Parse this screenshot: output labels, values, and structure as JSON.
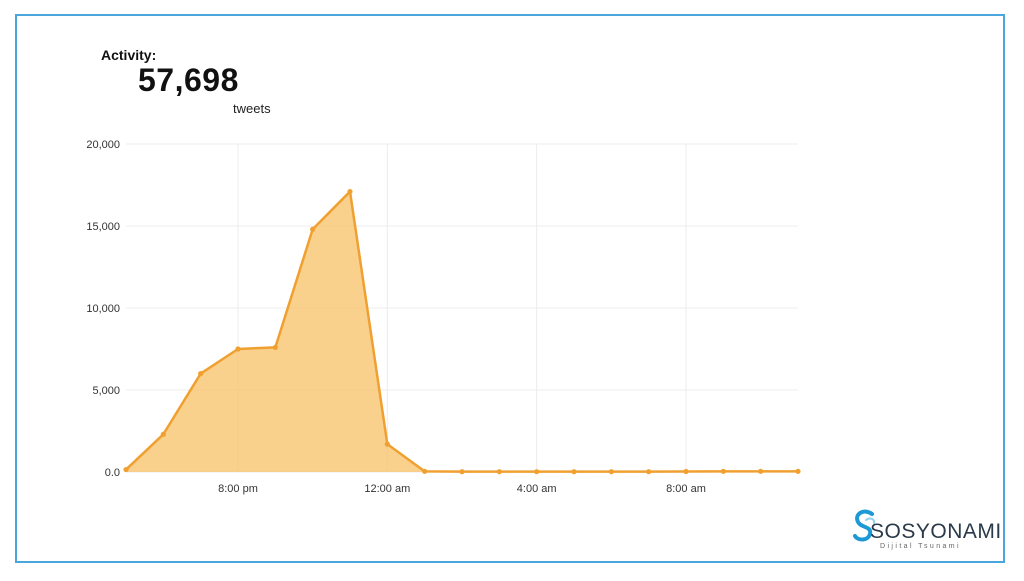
{
  "header": {
    "activity_label": "Activity:",
    "count": "57,698",
    "unit": "tweets"
  },
  "chart_data": {
    "type": "area",
    "title": "",
    "xlabel": "",
    "ylabel": "",
    "ylim": [
      0,
      20000
    ],
    "yticks": [
      0,
      5000,
      10000,
      15000,
      20000
    ],
    "ytick_labels": [
      "0.0",
      "5,000",
      "10,000",
      "15,000",
      "20,000"
    ],
    "xticks": [
      {
        "hour": 20,
        "label": "8:00 pm"
      },
      {
        "hour": 24,
        "label": "12:00 am"
      },
      {
        "hour": 28,
        "label": "4:00 am"
      },
      {
        "hour": 32,
        "label": "8:00 am"
      }
    ],
    "xlim": [
      17,
      35
    ],
    "grid": true,
    "color": "#f0a030",
    "fill_color": "#f8c878",
    "x": [
      17,
      18,
      19,
      20,
      21,
      22,
      23,
      24,
      25,
      26,
      27,
      28,
      29,
      30,
      31,
      32,
      33,
      34,
      35
    ],
    "values": [
      150,
      2300,
      6000,
      7500,
      7600,
      14800,
      17100,
      1700,
      40,
      20,
      20,
      20,
      20,
      20,
      20,
      30,
      40,
      40,
      40
    ]
  },
  "logo": {
    "name": "SOSYONAMI",
    "tagline": "Dijital Tsunami",
    "accent": "#1d9ad6"
  }
}
